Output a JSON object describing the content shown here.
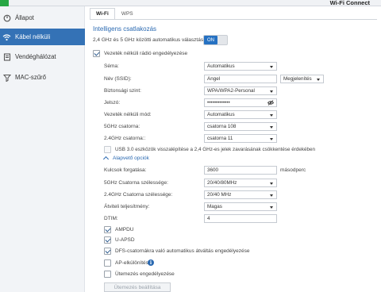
{
  "window": {
    "title": "Wi-Fi Connect"
  },
  "sidebar": {
    "items": [
      {
        "label": "Állapot",
        "icon": "status-icon"
      },
      {
        "label": "Kábel nélküli",
        "icon": "wifi-icon",
        "active": true
      },
      {
        "label": "Vendéghálózat",
        "icon": "guest-network-icon"
      },
      {
        "label": "MAC-szűrő",
        "icon": "mac-filter-icon"
      }
    ]
  },
  "tabs": [
    {
      "label": "Wi-Fi",
      "active": true
    },
    {
      "label": "WPS"
    }
  ],
  "smart": {
    "title": "Intelligens csatlakozás",
    "auto_switch_label": "2,4 GHz és 5 GHz közötti automatikus választás",
    "toggle_label": "ON"
  },
  "wireless": {
    "enable_label": "Vezeték nélküli rádió engedélyezése",
    "enabled": true,
    "schema_label": "Séma:",
    "schema_value": "Automatikus",
    "ssid_label": "Név (SSID):",
    "ssid_value": "Angel",
    "visibility_value": "Megjelenítés",
    "security_label": "Biztonsági szint:",
    "security_value": "WPA/WPA2-Personal",
    "password_label": "Jelszó:",
    "password_value": "•••••••••••••",
    "mode_label": "Vezeték nélküli mód:",
    "mode_value": "Automatikus",
    "ch5_label": "5GHz csatorna:",
    "ch5_value": "csatorna 108",
    "ch24_label": "2.4GHz csatorna::",
    "ch24_value": "csatorna 11",
    "usb3_label": "USB 3.0 eszközök visszalépítése a 2,4 GHz-es jelek zavarásának csökkentése érdekében"
  },
  "basic": {
    "toggle_label": "Alapvető opciók",
    "rotate_label": "Kulcsok forgatása:",
    "rotate_value": "3600",
    "rotate_unit": "másodperc",
    "bw5_label": "5GHz Csatorna szélessége:",
    "bw5_value": "20/40/80MHz",
    "bw24_label": "2.4GHz Csatorna szélessége:",
    "bw24_value": "20/40 MHz",
    "tx_label": "Átviteli teljesítmény:",
    "tx_value": "Magas",
    "dtim_label": "DTIM:",
    "dtim_value": "4",
    "ampdu_label": "AMPDU",
    "uapsd_label": "U-APSD",
    "dfs_label": "DFS-csatornákra való automatikus átváltás engedélyezése",
    "ap_isolation_label": "AP-elkülönítés",
    "schedule_label": "Ütemezés engedélyezése",
    "schedule_button": "Ütemezés beállítása"
  }
}
